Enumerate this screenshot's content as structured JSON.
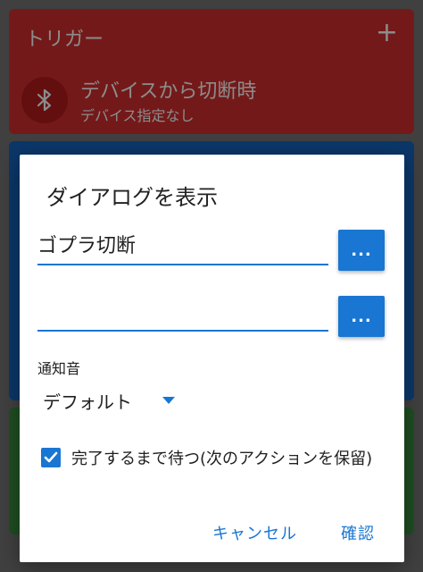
{
  "background": {
    "trigger_card": {
      "title": "トリガー",
      "add_symbol": "+",
      "item_title": "デバイスから切断時",
      "item_subtitle": "デバイス指定なし",
      "icon": "bluetooth-icon"
    },
    "colors": {
      "trigger": "#d32f2f",
      "middle": "#1565c0",
      "bottom": "#388e3c"
    }
  },
  "dialog": {
    "title": "ダイアログを表示",
    "field1": {
      "value": "ゴプラ切断",
      "button_label": "..."
    },
    "field2": {
      "value": "",
      "button_label": "..."
    },
    "notification_sound": {
      "label": "通知音",
      "value": "デフォルト"
    },
    "wait_checkbox": {
      "checked": true,
      "label": "完了するまで待つ(次のアクションを保留)"
    },
    "buttons": {
      "cancel": "キャンセル",
      "ok": "確認"
    },
    "accent_color": "#1976d2"
  }
}
